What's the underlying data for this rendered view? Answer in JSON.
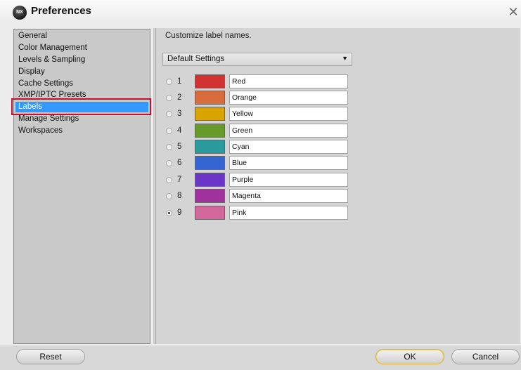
{
  "window": {
    "title": "Preferences"
  },
  "sidebar": {
    "items": [
      {
        "label": "General",
        "selected": false
      },
      {
        "label": "Color Management",
        "selected": false
      },
      {
        "label": "Levels & Sampling",
        "selected": false
      },
      {
        "label": "Display",
        "selected": false
      },
      {
        "label": "Cache Settings",
        "selected": false
      },
      {
        "label": "XMP/IPTC Presets",
        "selected": false
      },
      {
        "label": "Labels",
        "selected": true
      },
      {
        "label": "Manage Settings",
        "selected": false
      },
      {
        "label": "Workspaces",
        "selected": false
      }
    ]
  },
  "labels_page": {
    "heading": "Customize label names.",
    "preset_select": {
      "value": "Default Settings"
    },
    "rows": [
      {
        "number": "1",
        "color": "#d23232",
        "name": "Red",
        "selected": false
      },
      {
        "number": "2",
        "color": "#d86d3b",
        "name": "Orange",
        "selected": false
      },
      {
        "number": "3",
        "color": "#d9a400",
        "name": "Yellow",
        "selected": false
      },
      {
        "number": "4",
        "color": "#669b2c",
        "name": "Green",
        "selected": false
      },
      {
        "number": "5",
        "color": "#2a9a9c",
        "name": "Cyan",
        "selected": false
      },
      {
        "number": "6",
        "color": "#3565d0",
        "name": "Blue",
        "selected": false
      },
      {
        "number": "7",
        "color": "#6b35c8",
        "name": "Purple",
        "selected": false
      },
      {
        "number": "8",
        "color": "#a0329d",
        "name": "Magenta",
        "selected": false
      },
      {
        "number": "9",
        "color": "#d2689a",
        "name": "Pink",
        "selected": true
      }
    ]
  },
  "footer": {
    "reset_label": "Reset",
    "ok_label": "OK",
    "cancel_label": "Cancel"
  },
  "accent": {
    "selection": "#3399ff",
    "highlight_box": "#c8102e"
  }
}
